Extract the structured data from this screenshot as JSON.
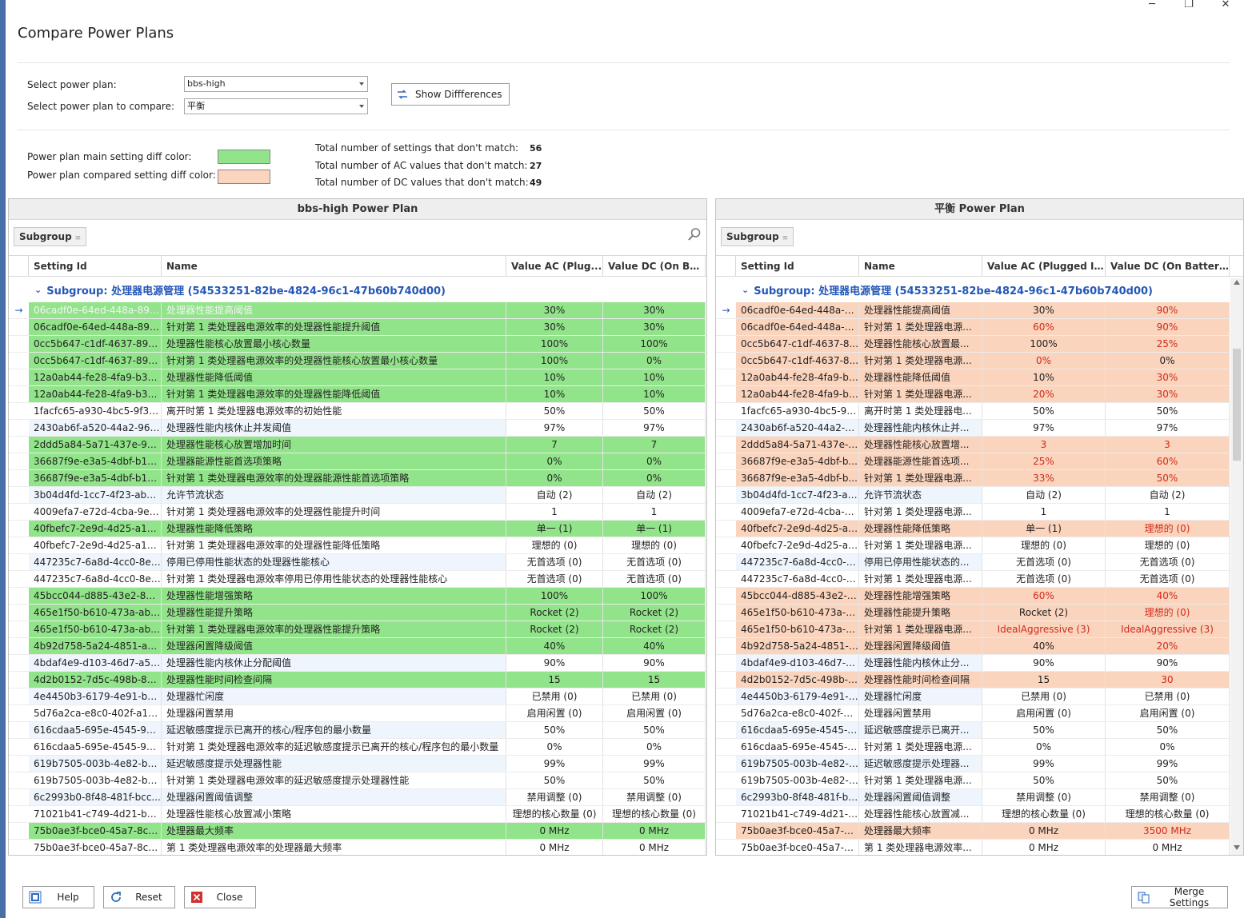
{
  "window": {
    "title": "Compare Power Plans",
    "minimize": "─",
    "maximize": "❐",
    "close": "✕"
  },
  "selectors": {
    "main_label": "Select power plan:",
    "main_value": "bbs-high",
    "compare_label": "Select power plan to compare:",
    "compare_value": "平衡",
    "show_diff_button": "Show Diffferences"
  },
  "legend": {
    "main_label": "Power plan main setting diff color:",
    "main_color": "#92e48a",
    "compare_label": "Power plan compared setting diff color:",
    "compare_color": "#fad4bd"
  },
  "stats": {
    "settings_label": "Total number of settings that don't match:",
    "settings_value": "56",
    "ac_label": "Total number of AC values that don't match:",
    "ac_value": "27",
    "dc_label": "Total number of DC values that don't match:",
    "dc_value": "49"
  },
  "left_panel": {
    "title": "bbs-high Power Plan",
    "group_chip": "Subgroup",
    "columns": [
      "Setting Id",
      "Name",
      "Value AC (Plug...",
      "Value DC (On Bat..."
    ],
    "group_row": "Subgroup: 处理器电源管理 (54533251-82be-4824-96c1-47b60b740d00)"
  },
  "right_panel": {
    "title": "平衡 Power Plan",
    "group_chip": "Subgroup",
    "columns": [
      "Setting Id",
      "Name",
      "Value AC (Plugged In)",
      "Value DC (On Battery)"
    ],
    "group_row": "Subgroup: 处理器电源管理 (54533251-82be-4824-96c1-47b60b740d00)"
  },
  "left_rows": [
    {
      "id": "06cadf0e-64ed-448a-892...",
      "name": "处理器性能提高阈值",
      "ac": "30%",
      "dc": "30%",
      "diff": true
    },
    {
      "id": "06cadf0e-64ed-448a-892...",
      "name": "针对第 1 类处理器电源效率的处理器性能提升阈值",
      "ac": "30%",
      "dc": "30%",
      "diff": true
    },
    {
      "id": "0cc5b647-c1df-4637-891...",
      "name": "处理器性能核心放置最小核心数量",
      "ac": "100%",
      "dc": "100%",
      "diff": true
    },
    {
      "id": "0cc5b647-c1df-4637-891...",
      "name": "针对第 1 类处理器电源效率的处理器性能核心放置最小核心数量",
      "ac": "100%",
      "dc": "0%",
      "diff": true
    },
    {
      "id": "12a0ab44-fe28-4fa9-b3b...",
      "name": "处理器性能降低阈值",
      "ac": "10%",
      "dc": "10%",
      "diff": true
    },
    {
      "id": "12a0ab44-fe28-4fa9-b3b...",
      "name": "针对第 1 类处理器电源效率的处理器性能降低阈值",
      "ac": "10%",
      "dc": "10%",
      "diff": true
    },
    {
      "id": "1facfc65-a930-4bc5-9f38...",
      "name": "离开时第 1 类处理器电源效率的初始性能",
      "ac": "50%",
      "dc": "50%",
      "diff": false
    },
    {
      "id": "2430ab6f-a520-44a2-960...",
      "name": "处理器性能内核休止并发阈值",
      "ac": "97%",
      "dc": "97%",
      "diff": false
    },
    {
      "id": "2ddd5a84-5a71-437e-912...",
      "name": "处理器性能核心放置增加时间",
      "ac": "7",
      "dc": "7",
      "diff": true
    },
    {
      "id": "36687f9e-e3a5-4dbf-b1d...",
      "name": "处理器能源性能首选项策略",
      "ac": "0%",
      "dc": "0%",
      "diff": true
    },
    {
      "id": "36687f9e-e3a5-4dbf-b1d...",
      "name": "针对第 1 类处理器电源效率的处理器能源性能首选项策略",
      "ac": "0%",
      "dc": "0%",
      "diff": true
    },
    {
      "id": "3b04d4fd-1cc7-4f23-ab1c...",
      "name": "允许节流状态",
      "ac": "自动 (2)",
      "dc": "自动 (2)",
      "diff": false
    },
    {
      "id": "4009efa7-e72d-4cba-9ed...",
      "name": "针对第 1 类处理器电源效率的处理器性能提升时间",
      "ac": "1",
      "dc": "1",
      "diff": false
    },
    {
      "id": "40fbefc7-2e9d-4d25-a18...",
      "name": "处理器性能降低策略",
      "ac": "单一 (1)",
      "dc": "单一 (1)",
      "diff": true
    },
    {
      "id": "40fbefc7-2e9d-4d25-a18...",
      "name": "针对第 1 类处理器电源效率的处理器性能降低策略",
      "ac": "理想的 (0)",
      "dc": "理想的 (0)",
      "diff": false
    },
    {
      "id": "447235c7-6a8d-4cc0-8e2...",
      "name": "停用已停用性能状态的处理器性能核心",
      "ac": "无首选项 (0)",
      "dc": "无首选项 (0)",
      "diff": false
    },
    {
      "id": "447235c7-6a8d-4cc0-8e2...",
      "name": "针对第 1 类处理器电源效率停用已停用性能状态的处理器性能核心",
      "ac": "无首选项 (0)",
      "dc": "无首选项 (0)",
      "diff": false
    },
    {
      "id": "45bcc044-d885-43e2-860...",
      "name": "处理器性能增强策略",
      "ac": "100%",
      "dc": "100%",
      "diff": true
    },
    {
      "id": "465e1f50-b610-473a-ab5...",
      "name": "处理器性能提升策略",
      "ac": "Rocket (2)",
      "dc": "Rocket (2)",
      "diff": true
    },
    {
      "id": "465e1f50-b610-473a-ab5...",
      "name": "针对第 1 类处理器电源效率的处理器性能提升策略",
      "ac": "Rocket (2)",
      "dc": "Rocket (2)",
      "diff": true
    },
    {
      "id": "4b92d758-5a24-4851-a47...",
      "name": "处理器闲置降级阈值",
      "ac": "40%",
      "dc": "40%",
      "diff": true
    },
    {
      "id": "4bdaf4e9-d103-46d7-a5f...",
      "name": "处理器性能内核休止分配阈值",
      "ac": "90%",
      "dc": "90%",
      "diff": false
    },
    {
      "id": "4d2b0152-7d5c-498b-88e...",
      "name": "处理器性能时间检查间隔",
      "ac": "15",
      "dc": "15",
      "diff": true
    },
    {
      "id": "4e4450b3-6179-4e91-b8f...",
      "name": "处理器忙闲度",
      "ac": "已禁用 (0)",
      "dc": "已禁用 (0)",
      "diff": false
    },
    {
      "id": "5d76a2ca-e8c0-402f-a13...",
      "name": "处理器闲置禁用",
      "ac": "启用闲置 (0)",
      "dc": "启用闲置 (0)",
      "diff": false
    },
    {
      "id": "616cdaa5-695e-4545-97a...",
      "name": "延迟敏感度提示已离开的核心/程序包的最小数量",
      "ac": "50%",
      "dc": "50%",
      "diff": false
    },
    {
      "id": "616cdaa5-695e-4545-97a...",
      "name": "针对第 1 类处理器电源效率的延迟敏感度提示已离开的核心/程序包的最小数量",
      "ac": "0%",
      "dc": "0%",
      "diff": false
    },
    {
      "id": "619b7505-003b-4e82-b7a...",
      "name": "延迟敏感度提示处理器性能",
      "ac": "99%",
      "dc": "99%",
      "diff": false
    },
    {
      "id": "619b7505-003b-4e82-b7a...",
      "name": "针对第 1 类处理器电源效率的延迟敏感度提示处理器性能",
      "ac": "50%",
      "dc": "50%",
      "diff": false
    },
    {
      "id": "6c2993b0-8f48-481f-bcc...",
      "name": "处理器闲置阈值调整",
      "ac": "禁用调整 (0)",
      "dc": "禁用调整 (0)",
      "diff": false
    },
    {
      "id": "71021b41-c749-4d21-be7...",
      "name": "处理器性能核心放置减小策略",
      "ac": "理想的核心数量 (0)",
      "dc": "理想的核心数量 (0)",
      "diff": false
    },
    {
      "id": "75b0ae3f-bce0-45a7-8c8...",
      "name": "处理器最大频率",
      "ac": "0 MHz",
      "dc": "0 MHz",
      "diff": true
    },
    {
      "id": "75b0ae3f-bce0-45a7-8c8...",
      "name": "第 1 类处理器电源效率的处理器最大频率",
      "ac": "0 MHz",
      "dc": "0 MHz",
      "diff": false
    }
  ],
  "right_rows": [
    {
      "id": "06cadf0e-64ed-448a-8...",
      "name": "处理器性能提高阈值",
      "ac": "30%",
      "dc": "90%",
      "diff": true,
      "ac_red": false,
      "dc_red": true
    },
    {
      "id": "06cadf0e-64ed-448a-8...",
      "name": "针对第 1 类处理器电源...",
      "ac": "60%",
      "dc": "90%",
      "diff": true,
      "ac_red": true,
      "dc_red": true
    },
    {
      "id": "0cc5b647-c1df-4637-8...",
      "name": "处理器性能核心放置最...",
      "ac": "100%",
      "dc": "25%",
      "diff": true,
      "ac_red": false,
      "dc_red": true
    },
    {
      "id": "0cc5b647-c1df-4637-8...",
      "name": "针对第 1 类处理器电源...",
      "ac": "0%",
      "dc": "0%",
      "diff": true,
      "ac_red": true,
      "dc_red": false
    },
    {
      "id": "12a0ab44-fe28-4fa9-b3...",
      "name": "处理器性能降低阈值",
      "ac": "10%",
      "dc": "30%",
      "diff": true,
      "ac_red": false,
      "dc_red": true
    },
    {
      "id": "12a0ab44-fe28-4fa9-b3...",
      "name": "针对第 1 类处理器电源...",
      "ac": "20%",
      "dc": "30%",
      "diff": true,
      "ac_red": true,
      "dc_red": true
    },
    {
      "id": "1facfc65-a930-4bc5-9f...",
      "name": "离开时第 1 类处理器电...",
      "ac": "50%",
      "dc": "50%",
      "diff": false,
      "ac_red": false,
      "dc_red": false
    },
    {
      "id": "2430ab6f-a520-44a2-9...",
      "name": "处理器性能内核休止并...",
      "ac": "97%",
      "dc": "97%",
      "diff": false,
      "ac_red": false,
      "dc_red": false
    },
    {
      "id": "2ddd5a84-5a71-437e-9...",
      "name": "处理器性能核心放置增...",
      "ac": "3",
      "dc": "3",
      "diff": true,
      "ac_red": true,
      "dc_red": true
    },
    {
      "id": "36687f9e-e3a5-4dbf-b...",
      "name": "处理器能源性能首选项...",
      "ac": "25%",
      "dc": "60%",
      "diff": true,
      "ac_red": true,
      "dc_red": true
    },
    {
      "id": "36687f9e-e3a5-4dbf-b...",
      "name": "针对第 1 类处理器电源...",
      "ac": "33%",
      "dc": "50%",
      "diff": true,
      "ac_red": true,
      "dc_red": true
    },
    {
      "id": "3b04d4fd-1cc7-4f23-ab...",
      "name": "允许节流状态",
      "ac": "自动 (2)",
      "dc": "自动 (2)",
      "diff": false,
      "ac_red": false,
      "dc_red": false
    },
    {
      "id": "4009efa7-e72d-4cba-9...",
      "name": "针对第 1 类处理器电源...",
      "ac": "1",
      "dc": "1",
      "diff": false,
      "ac_red": false,
      "dc_red": false
    },
    {
      "id": "40fbefc7-2e9d-4d25-a1...",
      "name": "处理器性能降低策略",
      "ac": "单一 (1)",
      "dc": "理想的 (0)",
      "diff": true,
      "ac_red": false,
      "dc_red": true
    },
    {
      "id": "40fbefc7-2e9d-4d25-a1...",
      "name": "针对第 1 类处理器电源...",
      "ac": "理想的 (0)",
      "dc": "理想的 (0)",
      "diff": false,
      "ac_red": false,
      "dc_red": false
    },
    {
      "id": "447235c7-6a8d-4cc0-8...",
      "name": "停用已停用性能状态的...",
      "ac": "无首选项 (0)",
      "dc": "无首选项 (0)",
      "diff": false,
      "ac_red": false,
      "dc_red": false
    },
    {
      "id": "447235c7-6a8d-4cc0-8...",
      "name": "针对第 1 类处理器电源...",
      "ac": "无首选项 (0)",
      "dc": "无首选项 (0)",
      "diff": false,
      "ac_red": false,
      "dc_red": false
    },
    {
      "id": "45bcc044-d885-43e2-8...",
      "name": "处理器性能增强策略",
      "ac": "60%",
      "dc": "40%",
      "diff": true,
      "ac_red": true,
      "dc_red": true
    },
    {
      "id": "465e1f50-b610-473a-a...",
      "name": "处理器性能提升策略",
      "ac": "Rocket (2)",
      "dc": "理想的 (0)",
      "diff": true,
      "ac_red": false,
      "dc_red": true
    },
    {
      "id": "465e1f50-b610-473a-a...",
      "name": "针对第 1 类处理器电源...",
      "ac": "IdealAggressive (3)",
      "dc": "IdealAggressive (3)",
      "diff": true,
      "ac_red": true,
      "dc_red": true
    },
    {
      "id": "4b92d758-5a24-4851-a...",
      "name": "处理器闲置降级阈值",
      "ac": "40%",
      "dc": "20%",
      "diff": true,
      "ac_red": false,
      "dc_red": true
    },
    {
      "id": "4bdaf4e9-d103-46d7-a...",
      "name": "处理器性能内核休止分...",
      "ac": "90%",
      "dc": "90%",
      "diff": false,
      "ac_red": false,
      "dc_red": false
    },
    {
      "id": "4d2b0152-7d5c-498b-8...",
      "name": "处理器性能时间检查间隔",
      "ac": "15",
      "dc": "30",
      "diff": true,
      "ac_red": false,
      "dc_red": true
    },
    {
      "id": "4e4450b3-6179-4e91-b...",
      "name": "处理器忙闲度",
      "ac": "已禁用 (0)",
      "dc": "已禁用 (0)",
      "diff": false,
      "ac_red": false,
      "dc_red": false
    },
    {
      "id": "5d76a2ca-e8c0-402f-a1...",
      "name": "处理器闲置禁用",
      "ac": "启用闲置 (0)",
      "dc": "启用闲置 (0)",
      "diff": false,
      "ac_red": false,
      "dc_red": false
    },
    {
      "id": "616cdaa5-695e-4545-9...",
      "name": "延迟敏感度提示已离开...",
      "ac": "50%",
      "dc": "50%",
      "diff": false,
      "ac_red": false,
      "dc_red": false
    },
    {
      "id": "616cdaa5-695e-4545-9...",
      "name": "针对第 1 类处理器电源...",
      "ac": "0%",
      "dc": "0%",
      "diff": false,
      "ac_red": false,
      "dc_red": false
    },
    {
      "id": "619b7505-003b-4e82-b...",
      "name": "延迟敏感度提示处理器...",
      "ac": "99%",
      "dc": "99%",
      "diff": false,
      "ac_red": false,
      "dc_red": false
    },
    {
      "id": "619b7505-003b-4e82-b...",
      "name": "针对第 1 类处理器电源...",
      "ac": "50%",
      "dc": "50%",
      "diff": false,
      "ac_red": false,
      "dc_red": false
    },
    {
      "id": "6c2993b0-8f48-481f-bc...",
      "name": "处理器闲置阈值调整",
      "ac": "禁用调整 (0)",
      "dc": "禁用调整 (0)",
      "diff": false,
      "ac_red": false,
      "dc_red": false
    },
    {
      "id": "71021b41-c749-4d21-b...",
      "name": "处理器性能核心放置减...",
      "ac": "理想的核心数量 (0)",
      "dc": "理想的核心数量 (0)",
      "diff": false,
      "ac_red": false,
      "dc_red": false
    },
    {
      "id": "75b0ae3f-bce0-45a7-8c...",
      "name": "处理器最大频率",
      "ac": "0 MHz",
      "dc": "3500 MHz",
      "diff": true,
      "ac_red": false,
      "dc_red": true
    },
    {
      "id": "75b0ae3f-bce0-45a7-8c...",
      "name": "第 1 类处理器电源效率...",
      "ac": "0 MHz",
      "dc": "0 MHz",
      "diff": false,
      "ac_red": false,
      "dc_red": false
    }
  ],
  "footer": {
    "help": "Help",
    "reset": "Reset",
    "close": "Close",
    "merge": "Merge Settings"
  }
}
